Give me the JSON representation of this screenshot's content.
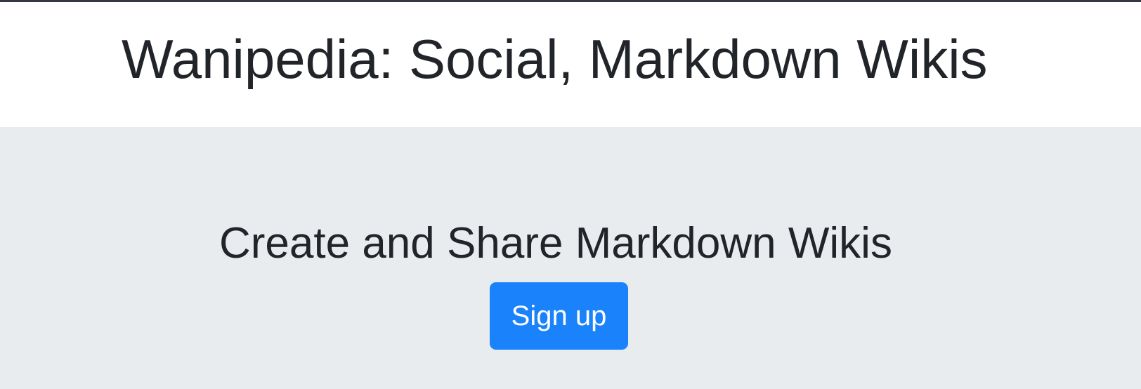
{
  "header": {
    "title": "Wanipedia: Social, Markdown Wikis"
  },
  "hero": {
    "heading": "Create and Share Markdown Wikis",
    "signup_label": "Sign up"
  },
  "colors": {
    "primary_button": "#1a82fb",
    "hero_background": "#e8ecef",
    "text": "#212529"
  }
}
